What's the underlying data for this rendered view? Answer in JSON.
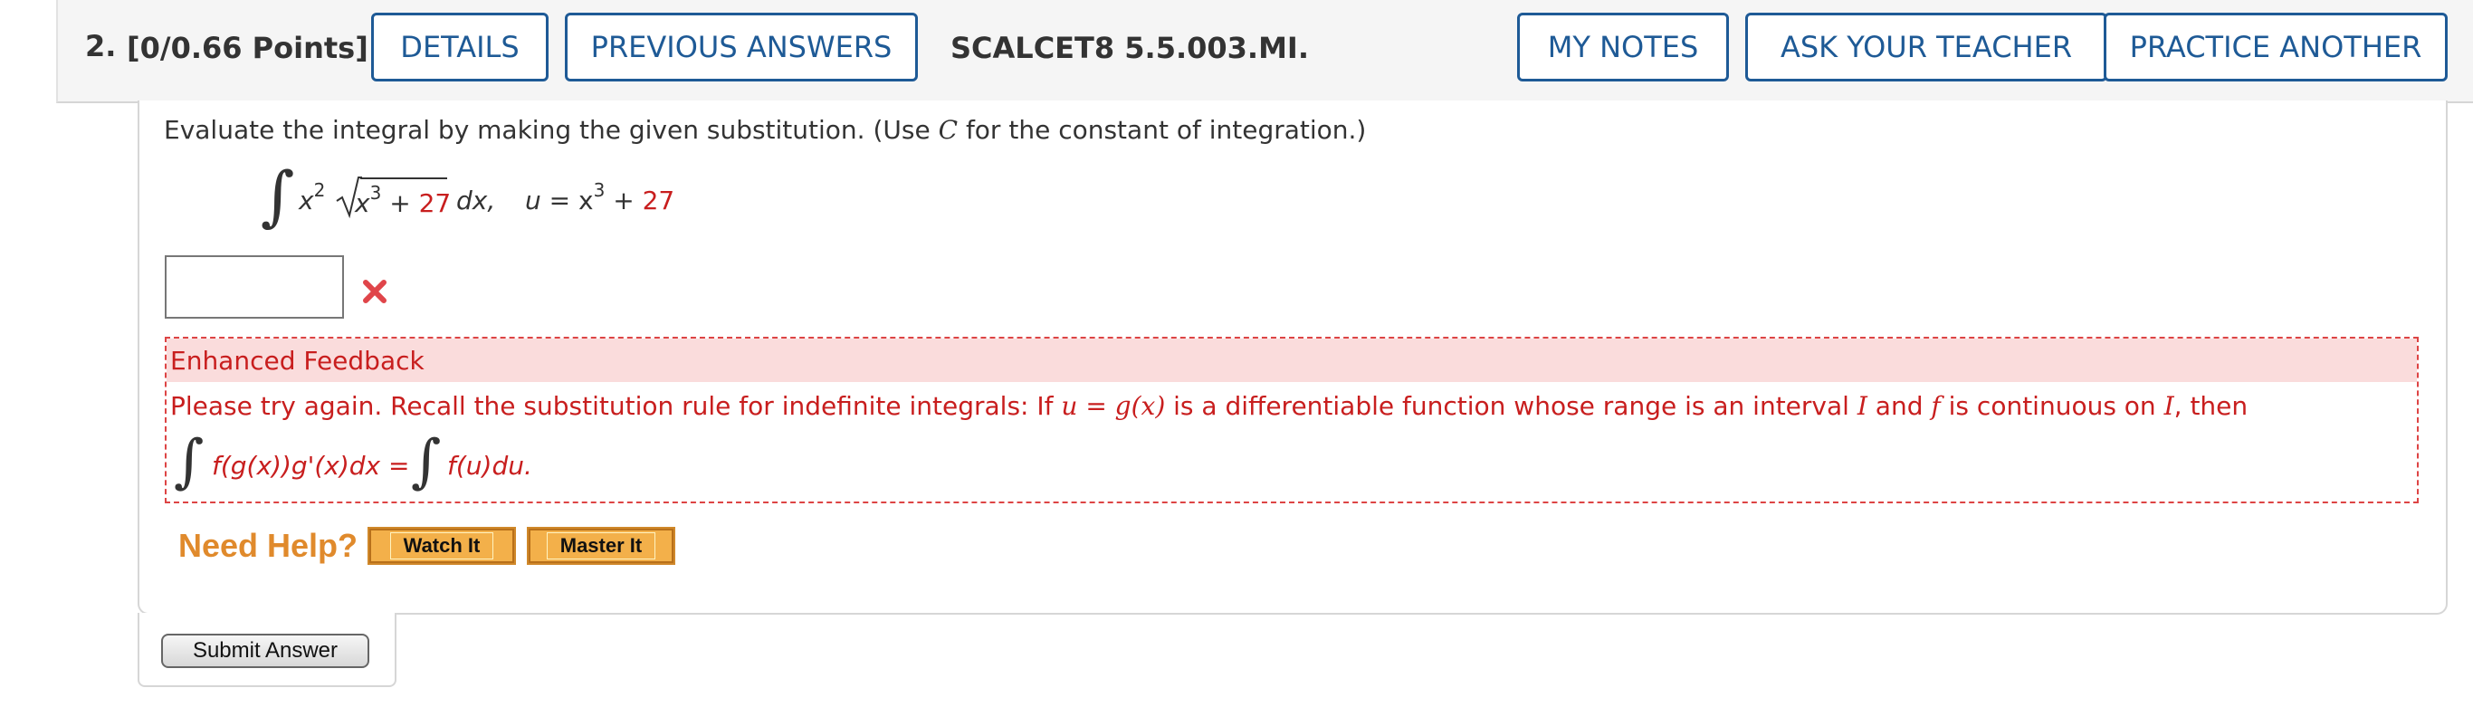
{
  "header": {
    "question_number": "2.",
    "points": "[0/0.66 Points]",
    "details_label": "DETAILS",
    "previous_answers_label": "PREVIOUS ANSWERS",
    "problem_id": "SCALCET8 5.5.003.MI.",
    "my_notes_label": "MY NOTES",
    "ask_teacher_label": "ASK YOUR TEACHER",
    "practice_another_label": "PRACTICE ANOTHER"
  },
  "question": {
    "instructions_pre": "Evaluate the integral by making the given substitution. (Use ",
    "instructions_var": "C",
    "instructions_post": " for the constant of integration.)",
    "integrand_x": "x",
    "integrand_power": "2",
    "radicand_x": "x",
    "radicand_power": "3",
    "radicand_plus": " + ",
    "radicand_const": "27",
    "dx": "dx,",
    "sub_u": "u",
    "sub_eq": " = x",
    "sub_power": "3",
    "sub_plus": " + ",
    "sub_const": "27"
  },
  "answer": {
    "value": "",
    "status": "incorrect"
  },
  "feedback": {
    "title": "Enhanced Feedback",
    "text_1": "Please try again. Recall the substitution rule for indefinite integrals: If ",
    "text_u": "u = g(x)",
    "text_2": " is a differentiable function whose range is an interval ",
    "text_I1": "I",
    "text_3": " and ",
    "text_f": "f",
    "text_4": " is continuous on ",
    "text_I2": "I",
    "text_5": ", then",
    "rule_left": "f(g(x))g'(x)dx =",
    "rule_right": "f(u)du."
  },
  "help": {
    "label": "Need Help?",
    "watch_label": "Watch It",
    "master_label": "Master It"
  },
  "submit_label": "Submit Answer",
  "colors": {
    "accent": "#1e5a96",
    "error": "#c81e1e",
    "feedback_bg": "#fadcdc",
    "help_orange": "#e08a2c"
  }
}
